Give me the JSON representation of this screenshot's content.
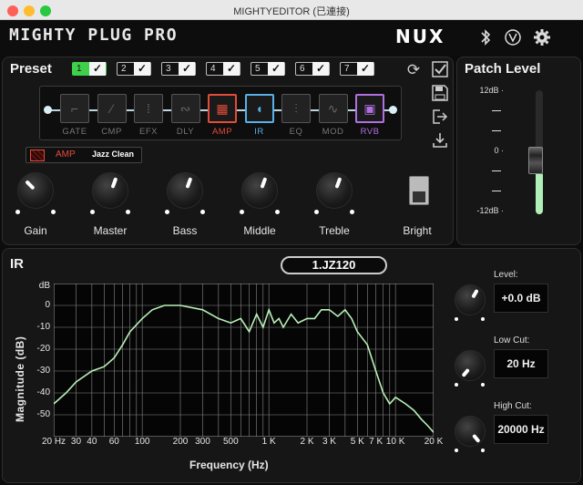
{
  "window": {
    "title": "MIGHTYEDITOR (已連接)"
  },
  "header": {
    "app_name": "MIGHTY PLUG PRO",
    "brand": "NUX",
    "icons": [
      "bluetooth-icon",
      "tuner-icon",
      "gear-icon"
    ]
  },
  "preset": {
    "title": "Preset",
    "slots": [
      {
        "num": "1",
        "active": true
      },
      {
        "num": "2",
        "active": false
      },
      {
        "num": "3",
        "active": false
      },
      {
        "num": "4",
        "active": false
      },
      {
        "num": "5",
        "active": false
      },
      {
        "num": "6",
        "active": false
      },
      {
        "num": "7",
        "active": false
      }
    ],
    "chain": [
      {
        "label": "GATE",
        "enabled": false,
        "color": "#777777"
      },
      {
        "label": "CMP",
        "enabled": false,
        "color": "#777777"
      },
      {
        "label": "EFX",
        "enabled": false,
        "color": "#777777"
      },
      {
        "label": "DLY",
        "enabled": false,
        "color": "#777777"
      },
      {
        "label": "AMP",
        "enabled": true,
        "color": "#e34b3b"
      },
      {
        "label": "IR",
        "enabled": true,
        "color": "#58b0e8"
      },
      {
        "label": "EQ",
        "enabled": false,
        "color": "#777777"
      },
      {
        "label": "MOD",
        "enabled": false,
        "color": "#777777"
      },
      {
        "label": "RVB",
        "enabled": true,
        "color": "#b070e0"
      }
    ],
    "amp": {
      "label": "AMP",
      "model": "Jazz Clean"
    },
    "knobs": [
      {
        "label": "Gain",
        "angle": -45
      },
      {
        "label": "Master",
        "angle": 20
      },
      {
        "label": "Bass",
        "angle": 20
      },
      {
        "label": "Middle",
        "angle": 20
      },
      {
        "label": "Treble",
        "angle": 20
      }
    ],
    "bright_label": "Bright"
  },
  "patch_level": {
    "title": "Patch Level",
    "scale": [
      "12dB",
      "",
      "",
      "0",
      "",
      "",
      "-12dB"
    ],
    "level_db": 0
  },
  "ir": {
    "title": "IR",
    "name": "1.JZ120",
    "controls": [
      {
        "label": "Level:",
        "value": "+0.0 dB"
      },
      {
        "label": "Low Cut:",
        "value": "20 Hz"
      },
      {
        "label": "High Cut:",
        "value": "20000 Hz"
      }
    ]
  },
  "chart_data": {
    "type": "line",
    "xlabel": "Frequency (Hz)",
    "ylabel": "Magnitude (dB)",
    "x_scale": "log",
    "xlim": [
      20,
      20000
    ],
    "ylim": [
      -60,
      10
    ],
    "x_ticks": [
      "20 Hz",
      "30",
      "40",
      "60",
      "100",
      "200",
      "300",
      "500",
      "1 K",
      "2 K",
      "3 K",
      "5 K",
      "7 K",
      "10 K",
      "20 K"
    ],
    "y_ticks": [
      "dB",
      "0",
      "-10",
      "-20",
      "-30",
      "-40",
      "-50"
    ],
    "grid": true,
    "series": [
      {
        "color": "#b8f0b8",
        "x": [
          20,
          25,
          30,
          40,
          50,
          60,
          70,
          80,
          100,
          120,
          150,
          200,
          300,
          400,
          500,
          600,
          700,
          800,
          900,
          1000,
          1100,
          1200,
          1300,
          1500,
          1700,
          2000,
          2300,
          2600,
          3000,
          3500,
          4000,
          4500,
          5000,
          6000,
          7000,
          8000,
          9000,
          10000,
          12000,
          14000,
          16000,
          18000,
          20000
        ],
        "y": [
          -45,
          -40,
          -35,
          -30,
          -28,
          -24,
          -18,
          -12,
          -6,
          -2,
          0,
          0,
          -2,
          -6,
          -8,
          -6,
          -12,
          -4,
          -10,
          -2,
          -8,
          -6,
          -10,
          -4,
          -8,
          -6,
          -6,
          -2,
          -2,
          -5,
          -2,
          -6,
          -12,
          -18,
          -30,
          -40,
          -45,
          -42,
          -45,
          -48,
          -52,
          -55,
          -58
        ]
      }
    ]
  }
}
